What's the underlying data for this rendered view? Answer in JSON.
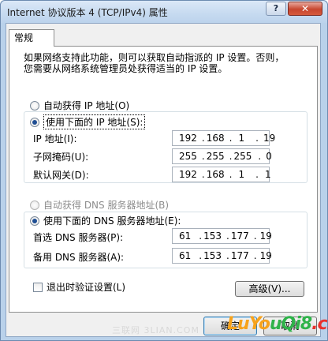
{
  "window": {
    "title": "Internet 协议版本 4 (TCP/IPv4) 属性",
    "help_label": "?",
    "close_label": "✕"
  },
  "tab": {
    "label": "常规"
  },
  "description": {
    "line1": "如果网络支持此功能，则可以获取自动指派的 IP 设置。否则，",
    "line2": "您需要从网络系统管理员处获得适当的 IP 设置。"
  },
  "ip_group": {
    "auto_label": "自动获得 IP 地址(O)",
    "manual_label": "使用下面的 IP 地址(S):",
    "selected": "manual",
    "fields": [
      {
        "label": "IP 地址(I):",
        "octets": [
          "192",
          "168",
          "1",
          "19"
        ]
      },
      {
        "label": "子网掩码(U):",
        "octets": [
          "255",
          "255",
          "255",
          "0"
        ]
      },
      {
        "label": "默认网关(D):",
        "octets": [
          "192",
          "168",
          "1",
          "1"
        ]
      }
    ]
  },
  "dns_group": {
    "auto_label": "自动获得 DNS 服务器地址(B)",
    "manual_label": "使用下面的 DNS 服务器地址(E):",
    "selected": "manual",
    "fields": [
      {
        "label": "首选 DNS 服务器(P):",
        "octets": [
          "61",
          "153",
          "177",
          "19"
        ]
      },
      {
        "label": "备用 DNS 服务器(A):",
        "octets": [
          "61",
          "153",
          "177",
          "19"
        ]
      }
    ]
  },
  "validate_checkbox": {
    "label": "退出时验证设置(L)",
    "checked": false
  },
  "advanced_button": {
    "label": "高级(V)..."
  },
  "ok_button": {
    "label": "确定"
  },
  "cancel_button": {
    "label": "取消"
  },
  "watermark": {
    "text": "三联网 3LIAN.COM"
  },
  "brand": {
    "text": "LuYouQi8.cn",
    "colors": [
      "#f7a21b",
      "#2fb34a",
      "#e9312c"
    ]
  }
}
